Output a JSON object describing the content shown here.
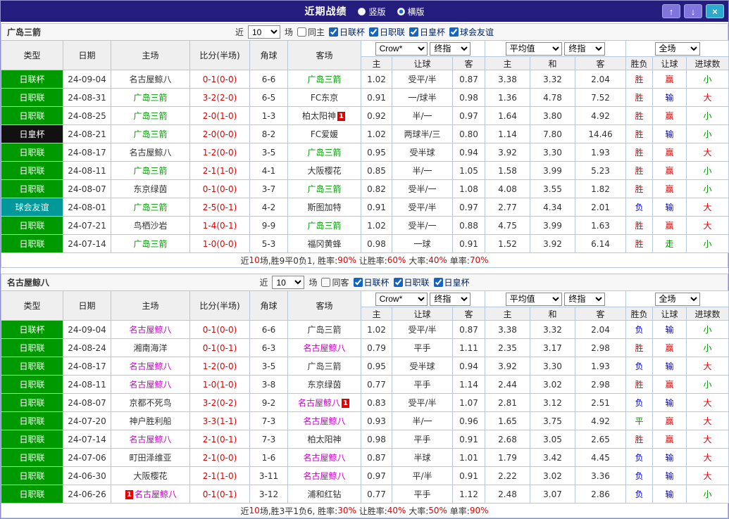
{
  "palette": {
    "red": "#e60000",
    "blue": "#0000cc",
    "green": "#009900",
    "magenta": "#cc00cc",
    "black": "#333333",
    "lgGreen": "#009a00",
    "lgBlack": "#111111",
    "lgTeal": "#009898"
  },
  "titlebar": {
    "title": "近期战绩",
    "radios": [
      {
        "label": "竖版",
        "selected": false
      },
      {
        "label": "横版",
        "selected": true
      }
    ],
    "buttons": {
      "up": "↑",
      "down": "↓",
      "close": "×"
    }
  },
  "table_headers": {
    "left": [
      "类型",
      "日期",
      "主场",
      "比分(半场)",
      "角球",
      "客场"
    ],
    "sub": [
      "主",
      "让球",
      "客",
      "主",
      "和",
      "客",
      "胜负",
      "让球",
      "进球数"
    ]
  },
  "sections": [
    {
      "team": "广岛三箭",
      "filter": {
        "near": "近",
        "count": "10",
        "games": "场",
        "same": "同主",
        "same_checked": false,
        "leagues": [
          {
            "label": "日联杯",
            "checked": true
          },
          {
            "label": "日职联",
            "checked": true
          },
          {
            "label": "日皇杯",
            "checked": true
          },
          {
            "label": "球会友谊",
            "checked": true
          }
        ]
      },
      "selects": {
        "asian_source": "Crow*",
        "asian_time": "终指",
        "euro_source": "平均值",
        "euro_time": "终指",
        "scope": "全场"
      },
      "rows": [
        {
          "league": "日联杯",
          "lbg": "lgGreen",
          "date": "24-09-04",
          "home": "名古屋鲸八",
          "homec": "black",
          "score": "0-1(0-0)",
          "corner": "6-6",
          "away": "广岛三箭",
          "awayc": "green",
          "asian": [
            "1.02",
            "受平/半",
            "0.87"
          ],
          "euro": [
            "3.38",
            "3.32",
            "2.04"
          ],
          "res": "胜",
          "resc": "red",
          "let": "赢",
          "letc": "red",
          "goal": "小",
          "goalc": "green"
        },
        {
          "league": "日职联",
          "lbg": "lgGreen",
          "date": "24-08-31",
          "home": "广岛三箭",
          "homec": "green",
          "score": "3-2(2-0)",
          "corner": "6-5",
          "away": "FC东京",
          "awayc": "black",
          "asian": [
            "0.91",
            "一/球半",
            "0.98"
          ],
          "euro": [
            "1.36",
            "4.78",
            "7.52"
          ],
          "res": "胜",
          "resc": "red",
          "let": "输",
          "letc": "blue",
          "goal": "大",
          "goalc": "red"
        },
        {
          "league": "日职联",
          "lbg": "lgGreen",
          "date": "24-08-25",
          "home": "广岛三箭",
          "homec": "green",
          "score": "2-0(1-0)",
          "corner": "1-3",
          "away": "柏太阳神",
          "awayc": "black",
          "away_badge": "1",
          "asian": [
            "0.92",
            "半/一",
            "0.97"
          ],
          "euro": [
            "1.64",
            "3.80",
            "4.92"
          ],
          "res": "胜",
          "resc": "red",
          "let": "赢",
          "letc": "red",
          "goal": "小",
          "goalc": "green"
        },
        {
          "league": "日皇杯",
          "lbg": "lgBlack",
          "date": "24-08-21",
          "home": "广岛三箭",
          "homec": "green",
          "score": "2-0(0-0)",
          "corner": "8-2",
          "away": "FC爱媛",
          "awayc": "black",
          "asian": [
            "1.02",
            "两球半/三",
            "0.80"
          ],
          "euro": [
            "1.14",
            "7.80",
            "14.46"
          ],
          "res": "胜",
          "resc": "red",
          "let": "输",
          "letc": "blue",
          "goal": "小",
          "goalc": "green"
        },
        {
          "league": "日职联",
          "lbg": "lgGreen",
          "date": "24-08-17",
          "home": "名古屋鲸八",
          "homec": "black",
          "score": "1-2(0-0)",
          "corner": "3-5",
          "away": "广岛三箭",
          "awayc": "green",
          "asian": [
            "0.95",
            "受半球",
            "0.94"
          ],
          "euro": [
            "3.92",
            "3.30",
            "1.93"
          ],
          "res": "胜",
          "resc": "red",
          "let": "赢",
          "letc": "red",
          "goal": "大",
          "goalc": "red"
        },
        {
          "league": "日职联",
          "lbg": "lgGreen",
          "date": "24-08-11",
          "home": "广岛三箭",
          "homec": "green",
          "score": "2-1(1-0)",
          "corner": "4-1",
          "away": "大阪樱花",
          "awayc": "black",
          "asian": [
            "0.85",
            "半/一",
            "1.05"
          ],
          "euro": [
            "1.58",
            "3.99",
            "5.23"
          ],
          "res": "胜",
          "resc": "red",
          "let": "赢",
          "letc": "red",
          "goal": "小",
          "goalc": "green"
        },
        {
          "league": "日职联",
          "lbg": "lgGreen",
          "date": "24-08-07",
          "home": "东京绿茵",
          "homec": "black",
          "score": "0-1(0-0)",
          "corner": "3-7",
          "away": "广岛三箭",
          "awayc": "green",
          "asian": [
            "0.82",
            "受半/一",
            "1.08"
          ],
          "euro": [
            "4.08",
            "3.55",
            "1.82"
          ],
          "res": "胜",
          "resc": "red",
          "let": "赢",
          "letc": "red",
          "goal": "小",
          "goalc": "green"
        },
        {
          "league": "球会友谊",
          "lbg": "lgTeal",
          "date": "24-08-01",
          "home": "广岛三箭",
          "homec": "green",
          "score": "2-5(0-1)",
          "corner": "4-2",
          "away": "斯图加特",
          "awayc": "black",
          "asian": [
            "0.91",
            "受平/半",
            "0.97"
          ],
          "euro": [
            "2.77",
            "4.34",
            "2.01"
          ],
          "res": "负",
          "resc": "blue",
          "let": "输",
          "letc": "blue",
          "goal": "大",
          "goalc": "red"
        },
        {
          "league": "日职联",
          "lbg": "lgGreen",
          "date": "24-07-21",
          "home": "鸟栖沙岩",
          "homec": "black",
          "score": "1-4(0-1)",
          "corner": "9-9",
          "away": "广岛三箭",
          "awayc": "green",
          "asian": [
            "1.02",
            "受半/一",
            "0.88"
          ],
          "euro": [
            "4.75",
            "3.99",
            "1.63"
          ],
          "res": "胜",
          "resc": "red",
          "let": "赢",
          "letc": "red",
          "goal": "大",
          "goalc": "red"
        },
        {
          "league": "日职联",
          "lbg": "lgGreen",
          "date": "24-07-14",
          "home": "广岛三箭",
          "homec": "green",
          "score": "1-0(0-0)",
          "corner": "5-3",
          "away": "福冈黄蜂",
          "awayc": "black",
          "asian": [
            "0.98",
            "一球",
            "0.91"
          ],
          "euro": [
            "1.52",
            "3.92",
            "6.14"
          ],
          "res": "胜",
          "resc": "red",
          "let": "走",
          "letc": "green",
          "goal": "小",
          "goalc": "green"
        }
      ],
      "summary": [
        {
          "text": "近",
          "color": "black"
        },
        {
          "text": "10",
          "color": "red"
        },
        {
          "text": "场,胜9平0负1, 胜率:",
          "color": "black"
        },
        {
          "text": "90%",
          "color": "red"
        },
        {
          "text": " 让胜率:",
          "color": "black"
        },
        {
          "text": "60%",
          "color": "red"
        },
        {
          "text": " 大率:",
          "color": "black"
        },
        {
          "text": "40%",
          "color": "red"
        },
        {
          "text": " 单率:",
          "color": "black"
        },
        {
          "text": "70%",
          "color": "red"
        }
      ]
    },
    {
      "team": "名古屋鲸八",
      "filter": {
        "near": "近",
        "count": "10",
        "games": "场",
        "same": "同客",
        "same_checked": false,
        "leagues": [
          {
            "label": "日联杯",
            "checked": true
          },
          {
            "label": "日职联",
            "checked": true
          },
          {
            "label": "日皇杯",
            "checked": true
          }
        ]
      },
      "selects": {
        "asian_source": "Crow*",
        "asian_time": "终指",
        "euro_source": "平均值",
        "euro_time": "终指",
        "scope": "全场"
      },
      "rows": [
        {
          "league": "日联杯",
          "lbg": "lgGreen",
          "date": "24-09-04",
          "home": "名古屋鲸八",
          "homec": "magenta",
          "score": "0-1(0-0)",
          "corner": "6-6",
          "away": "广岛三箭",
          "awayc": "black",
          "asian": [
            "1.02",
            "受平/半",
            "0.87"
          ],
          "euro": [
            "3.38",
            "3.32",
            "2.04"
          ],
          "res": "负",
          "resc": "blue",
          "let": "输",
          "letc": "blue",
          "goal": "小",
          "goalc": "green"
        },
        {
          "league": "日职联",
          "lbg": "lgGreen",
          "date": "24-08-24",
          "home": "湘南海洋",
          "homec": "black",
          "score": "0-1(0-1)",
          "corner": "6-3",
          "away": "名古屋鲸八",
          "awayc": "magenta",
          "asian": [
            "0.79",
            "平手",
            "1.11"
          ],
          "euro": [
            "2.35",
            "3.17",
            "2.98"
          ],
          "res": "胜",
          "resc": "red",
          "let": "赢",
          "letc": "red",
          "goal": "小",
          "goalc": "green"
        },
        {
          "league": "日职联",
          "lbg": "lgGreen",
          "date": "24-08-17",
          "home": "名古屋鲸八",
          "homec": "magenta",
          "score": "1-2(0-0)",
          "corner": "3-5",
          "away": "广岛三箭",
          "awayc": "black",
          "asian": [
            "0.95",
            "受半球",
            "0.94"
          ],
          "euro": [
            "3.92",
            "3.30",
            "1.93"
          ],
          "res": "负",
          "resc": "blue",
          "let": "输",
          "letc": "blue",
          "goal": "大",
          "goalc": "red"
        },
        {
          "league": "日职联",
          "lbg": "lgGreen",
          "date": "24-08-11",
          "home": "名古屋鲸八",
          "homec": "magenta",
          "score": "1-0(1-0)",
          "corner": "3-8",
          "away": "东京绿茵",
          "awayc": "black",
          "asian": [
            "0.77",
            "平手",
            "1.14"
          ],
          "euro": [
            "2.44",
            "3.02",
            "2.98"
          ],
          "res": "胜",
          "resc": "red",
          "let": "赢",
          "letc": "red",
          "goal": "小",
          "goalc": "green"
        },
        {
          "league": "日职联",
          "lbg": "lgGreen",
          "date": "24-08-07",
          "home": "京都不死鸟",
          "homec": "black",
          "score": "3-2(0-2)",
          "corner": "9-2",
          "away": "名古屋鲸八",
          "awayc": "magenta",
          "away_badge": "1",
          "asian": [
            "0.83",
            "受平/半",
            "1.07"
          ],
          "euro": [
            "2.81",
            "3.12",
            "2.51"
          ],
          "res": "负",
          "resc": "blue",
          "let": "输",
          "letc": "blue",
          "goal": "大",
          "goalc": "red"
        },
        {
          "league": "日职联",
          "lbg": "lgGreen",
          "date": "24-07-20",
          "home": "神户胜利船",
          "homec": "black",
          "score": "3-3(1-1)",
          "corner": "7-3",
          "away": "名古屋鲸八",
          "awayc": "magenta",
          "asian": [
            "0.93",
            "半/一",
            "0.96"
          ],
          "euro": [
            "1.65",
            "3.75",
            "4.92"
          ],
          "res": "平",
          "resc": "green",
          "let": "赢",
          "letc": "red",
          "goal": "大",
          "goalc": "red"
        },
        {
          "league": "日职联",
          "lbg": "lgGreen",
          "date": "24-07-14",
          "home": "名古屋鲸八",
          "homec": "magenta",
          "score": "2-1(0-1)",
          "corner": "7-3",
          "away": "柏太阳神",
          "awayc": "black",
          "asian": [
            "0.98",
            "平手",
            "0.91"
          ],
          "euro": [
            "2.68",
            "3.05",
            "2.65"
          ],
          "res": "胜",
          "resc": "red",
          "let": "赢",
          "letc": "red",
          "goal": "大",
          "goalc": "red"
        },
        {
          "league": "日职联",
          "lbg": "lgGreen",
          "date": "24-07-06",
          "home": "町田泽维亚",
          "homec": "black",
          "score": "2-1(0-0)",
          "corner": "1-6",
          "away": "名古屋鲸八",
          "awayc": "magenta",
          "asian": [
            "0.87",
            "半球",
            "1.01"
          ],
          "euro": [
            "1.79",
            "3.42",
            "4.45"
          ],
          "res": "负",
          "resc": "blue",
          "let": "输",
          "letc": "blue",
          "goal": "大",
          "goalc": "red"
        },
        {
          "league": "日职联",
          "lbg": "lgGreen",
          "date": "24-06-30",
          "home": "大阪樱花",
          "homec": "black",
          "score": "2-1(1-0)",
          "corner": "3-11",
          "away": "名古屋鲸八",
          "awayc": "magenta",
          "asian": [
            "0.97",
            "平/半",
            "0.91"
          ],
          "euro": [
            "2.22",
            "3.02",
            "3.36"
          ],
          "res": "负",
          "resc": "blue",
          "let": "输",
          "letc": "blue",
          "goal": "大",
          "goalc": "red"
        },
        {
          "league": "日职联",
          "lbg": "lgGreen",
          "date": "24-06-26",
          "home": "名古屋鲸八",
          "homec": "magenta",
          "home_badge": "1",
          "home_badge_pos": "before",
          "score": "0-1(0-1)",
          "corner": "3-12",
          "away": "浦和红钻",
          "awayc": "black",
          "asian": [
            "0.77",
            "平手",
            "1.12"
          ],
          "euro": [
            "2.48",
            "3.07",
            "2.86"
          ],
          "res": "负",
          "resc": "blue",
          "let": "输",
          "letc": "blue",
          "goal": "小",
          "goalc": "green"
        }
      ],
      "summary": [
        {
          "text": "近",
          "color": "black"
        },
        {
          "text": "10",
          "color": "red"
        },
        {
          "text": "场,胜3平1负6, 胜率:",
          "color": "black"
        },
        {
          "text": "30%",
          "color": "red"
        },
        {
          "text": " 让胜率:",
          "color": "black"
        },
        {
          "text": "40%",
          "color": "red"
        },
        {
          "text": " 大率:",
          "color": "black"
        },
        {
          "text": "50%",
          "color": "red"
        },
        {
          "text": " 单率:",
          "color": "black"
        },
        {
          "text": "90%",
          "color": "red"
        }
      ]
    }
  ]
}
